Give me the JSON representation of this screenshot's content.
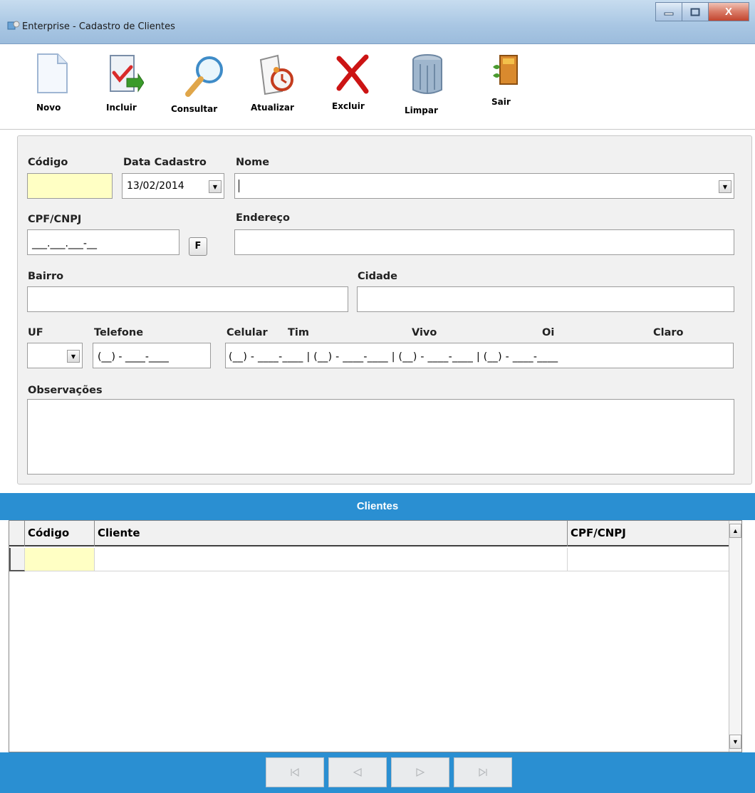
{
  "window": {
    "title": "Enterprise - Cadastro de Clientes",
    "close_glyph": "X"
  },
  "toolbar": {
    "novo": "Novo",
    "incluir": "Incluir",
    "consultar": "Consultar",
    "atualizar": "Atualizar",
    "excluir": "Excluir",
    "limpar": "Limpar",
    "sair": "Sair"
  },
  "form": {
    "codigo_label": "Código",
    "codigo_value": "",
    "data_cadastro_label": "Data Cadastro",
    "data_cadastro_value": "13/02/2014",
    "nome_label": "Nome",
    "nome_value": "",
    "cpf_label": "CPF/CNPJ",
    "cpf_mask": "___.___.___-__",
    "f_button": "F",
    "endereco_label": "Endereço",
    "bairro_label": "Bairro",
    "cidade_label": "Cidade",
    "uf_label": "UF",
    "telefone_label": "Telefone",
    "telefone_mask": "(__) - ____-____",
    "celular_label": "Celular",
    "tim_label": "Tim",
    "vivo_label": "Vivo",
    "oi_label": "Oi",
    "claro_label": "Claro",
    "celular_mask": "(__) - ____-____ | (__) - ____-____ | (__) - ____-____ | (__) - ____-____",
    "observacoes_label": "Observações"
  },
  "grid": {
    "title": "Clientes",
    "columns": [
      "Código",
      "Cliente",
      "CPF/CNPJ"
    ]
  },
  "nav": {
    "first": "first-record-icon",
    "prior": "prior-record-icon",
    "next": "next-record-icon",
    "last": "last-record-icon"
  },
  "colors": {
    "accent": "#2a8fd2",
    "key_field": "#ffffc4"
  }
}
